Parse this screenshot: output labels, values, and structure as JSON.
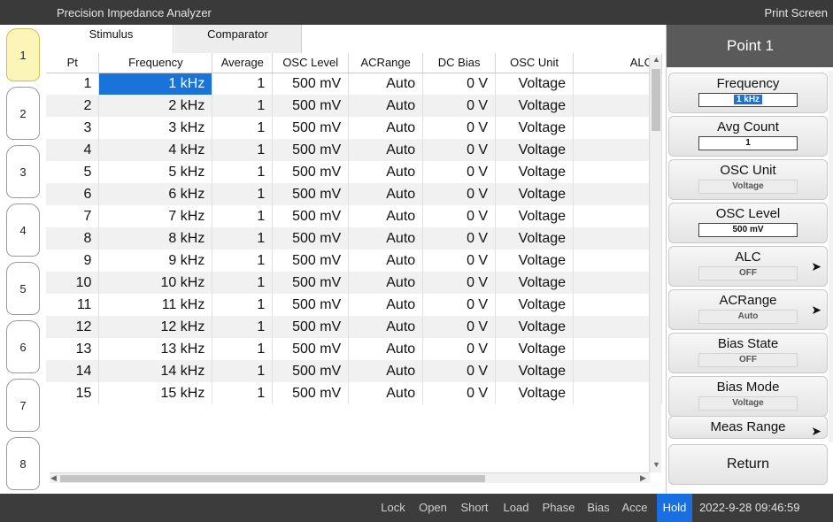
{
  "app": {
    "title": "Precision Impedance Analyzer",
    "print_screen": "Print Screen"
  },
  "side_tabs": [
    "1",
    "2",
    "3",
    "4",
    "5",
    "6",
    "7",
    "8"
  ],
  "tabs": {
    "stimulus": "Stimulus",
    "comparator": "Comparator"
  },
  "table": {
    "headers": [
      "Pt",
      "Frequency",
      "Average",
      "OSC Level",
      "ACRange",
      "DC Bias",
      "OSC Unit",
      "ALC"
    ],
    "rows": [
      [
        "1",
        "1 kHz",
        "1",
        "500 mV",
        "Auto",
        "0 V",
        "Voltage"
      ],
      [
        "2",
        "2 kHz",
        "1",
        "500 mV",
        "Auto",
        "0 V",
        "Voltage"
      ],
      [
        "3",
        "3 kHz",
        "1",
        "500 mV",
        "Auto",
        "0 V",
        "Voltage"
      ],
      [
        "4",
        "4 kHz",
        "1",
        "500 mV",
        "Auto",
        "0 V",
        "Voltage"
      ],
      [
        "5",
        "5 kHz",
        "1",
        "500 mV",
        "Auto",
        "0 V",
        "Voltage"
      ],
      [
        "6",
        "6 kHz",
        "1",
        "500 mV",
        "Auto",
        "0 V",
        "Voltage"
      ],
      [
        "7",
        "7 kHz",
        "1",
        "500 mV",
        "Auto",
        "0 V",
        "Voltage"
      ],
      [
        "8",
        "8 kHz",
        "1",
        "500 mV",
        "Auto",
        "0 V",
        "Voltage"
      ],
      [
        "9",
        "9 kHz",
        "1",
        "500 mV",
        "Auto",
        "0 V",
        "Voltage"
      ],
      [
        "10",
        "10 kHz",
        "1",
        "500 mV",
        "Auto",
        "0 V",
        "Voltage"
      ],
      [
        "11",
        "11 kHz",
        "1",
        "500 mV",
        "Auto",
        "0 V",
        "Voltage"
      ],
      [
        "12",
        "12 kHz",
        "1",
        "500 mV",
        "Auto",
        "0 V",
        "Voltage"
      ],
      [
        "13",
        "13 kHz",
        "1",
        "500 mV",
        "Auto",
        "0 V",
        "Voltage"
      ],
      [
        "14",
        "14 kHz",
        "1",
        "500 mV",
        "Auto",
        "0 V",
        "Voltage"
      ],
      [
        "15",
        "15 kHz",
        "1",
        "500 mV",
        "Auto",
        "0 V",
        "Voltage"
      ]
    ]
  },
  "panel": {
    "header": "Point 1",
    "keys": [
      {
        "label": "Frequency",
        "value": "1 kHz"
      },
      {
        "label": "Avg Count",
        "value": "1"
      },
      {
        "label": "OSC Unit",
        "value": "Voltage"
      },
      {
        "label": "OSC Level",
        "value": "500 mV"
      },
      {
        "label": "ALC",
        "value": "OFF"
      },
      {
        "label": "ACRange",
        "value": "Auto"
      },
      {
        "label": "Bias State",
        "value": "OFF"
      },
      {
        "label": "Bias Mode",
        "value": "Voltage"
      },
      {
        "label": "Meas Range",
        "value": ""
      }
    ],
    "return_label": "Return"
  },
  "status": {
    "items": [
      "Lock",
      "Open",
      "Short",
      "Load",
      "Phase",
      "Bias",
      "Acce",
      "Hold"
    ],
    "datetime": "2022-9-28 09:46:59"
  },
  "colors": {
    "selection": "#1a73d9",
    "side_tab_active": "#fbf5b8",
    "hold": "#1a6fe0"
  }
}
